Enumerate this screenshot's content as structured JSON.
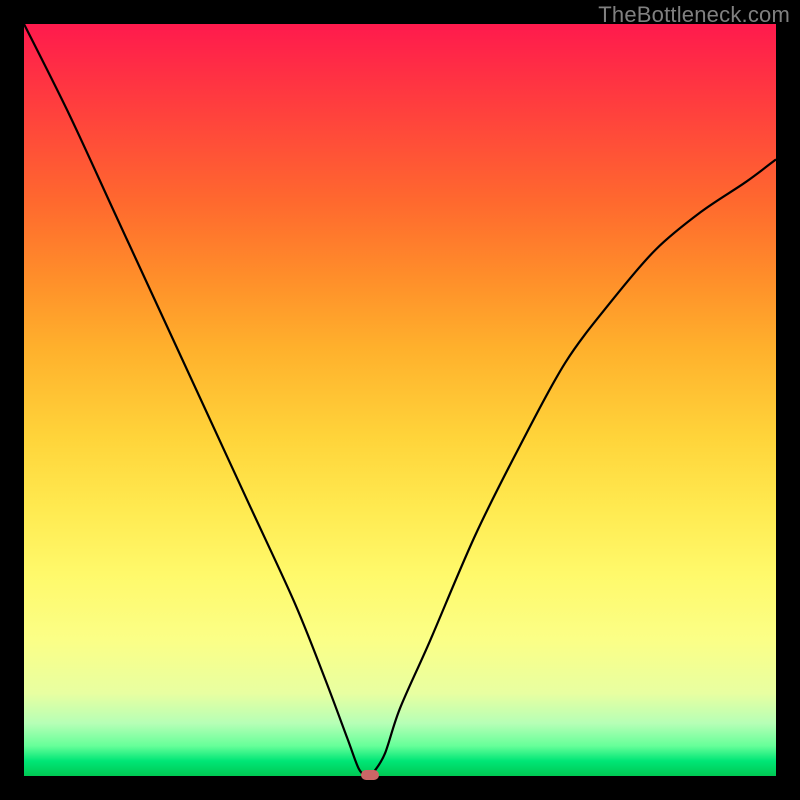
{
  "watermark": "TheBottleneck.com",
  "colors": {
    "frame": "#000000",
    "curve": "#000000",
    "marker": "#cc6666",
    "watermark": "#808080"
  },
  "chart_data": {
    "type": "line",
    "title": "",
    "xlabel": "",
    "ylabel": "",
    "xlim": [
      0,
      100
    ],
    "ylim": [
      0,
      100
    ],
    "grid": false,
    "legend": false,
    "series": [
      {
        "name": "bottleneck-curve",
        "x": [
          0,
          6,
          12,
          18,
          24,
          30,
          36,
          40,
          43,
          44.5,
          45.5,
          46,
          46.5,
          48,
          50,
          54,
          60,
          66,
          72,
          78,
          84,
          90,
          96,
          100
        ],
        "values": [
          100,
          88,
          75,
          62,
          49,
          36,
          23,
          13,
          5,
          1,
          0,
          0,
          0.5,
          3,
          9,
          18,
          32,
          44,
          55,
          63,
          70,
          75,
          79,
          82
        ]
      }
    ],
    "marker": {
      "x": 46,
      "y": 0
    },
    "annotations": []
  }
}
